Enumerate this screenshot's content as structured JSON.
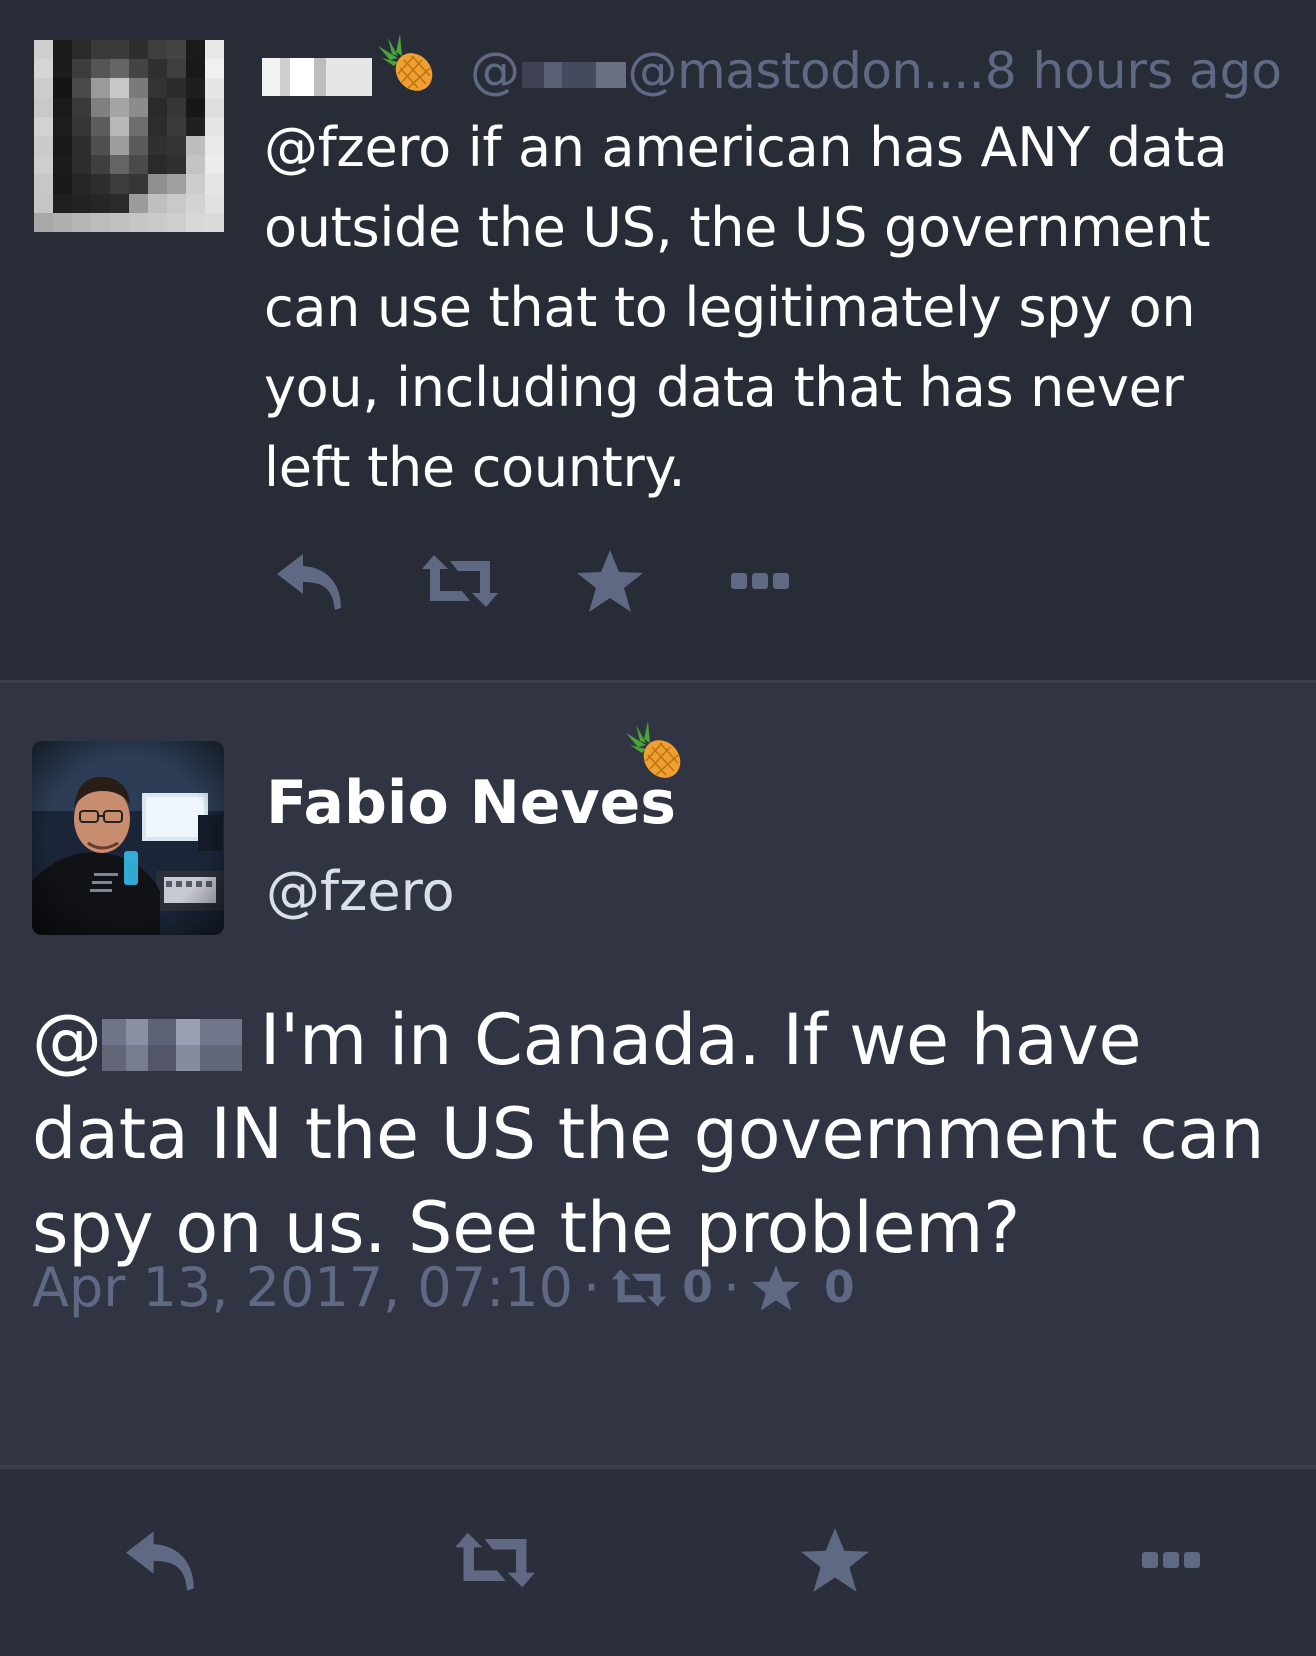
{
  "reply_status": {
    "display_name": "",
    "name_emoji": "pineapple-icon",
    "handle_prefix": "@",
    "handle_suffix": "@mastodon....",
    "timestamp": "8 hours ago",
    "content": "@fzero if an american has ANY data outside the US, the US government can use that to legitimately spy on you, including data that has never left the country.",
    "actions": [
      "reply-icon",
      "boost-icon",
      "favourite-icon",
      "more-icon"
    ]
  },
  "detailed_status": {
    "display_name": "Fabio Neves",
    "name_emoji": "pineapple-icon",
    "handle": "@fzero",
    "mention_prefix": "@",
    "content": "I'm in Canada. If we have data IN the US the government can spy on us. See the problem?",
    "meta": {
      "datetime": "Apr 13, 2017, 07:10",
      "separator": "·",
      "boost_count": "0",
      "favourite_count": "0"
    }
  },
  "action_bar": [
    "reply-icon",
    "boost-icon",
    "favourite-icon",
    "more-icon"
  ],
  "colors": {
    "background": "#282c37",
    "detail_background": "#313543",
    "muted_text": "#606984",
    "text": "#ffffff"
  }
}
